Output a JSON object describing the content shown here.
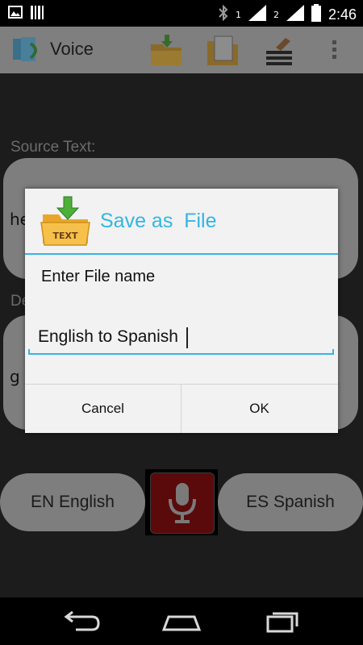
{
  "status_bar": {
    "sim1_label": "1",
    "sim2_label": "2",
    "time": "2:46"
  },
  "action_bar": {
    "title": "Voice"
  },
  "content": {
    "source_label": "Source Text:",
    "source_value": "he",
    "dest_label_partial": "De",
    "dest_value": "g",
    "lang_left": "EN English",
    "lang_right": "ES Spanish"
  },
  "dialog": {
    "title": "Save as  File",
    "icon_label": "TEXT",
    "message": "Enter File name",
    "input_value": "English to Spanish",
    "cancel_label": "Cancel",
    "ok_label": "OK"
  },
  "colors": {
    "accent": "#33b5e5",
    "dialog_bg": "#f2f2f2",
    "dim_bg": "#1c1c1c"
  },
  "icons": [
    "gallery-icon",
    "barcode-icon",
    "bluetooth-icon",
    "signal-icon",
    "battery-icon",
    "back-icon",
    "home-icon",
    "recents-icon",
    "microphone-icon",
    "overflow-menu-icon"
  ]
}
